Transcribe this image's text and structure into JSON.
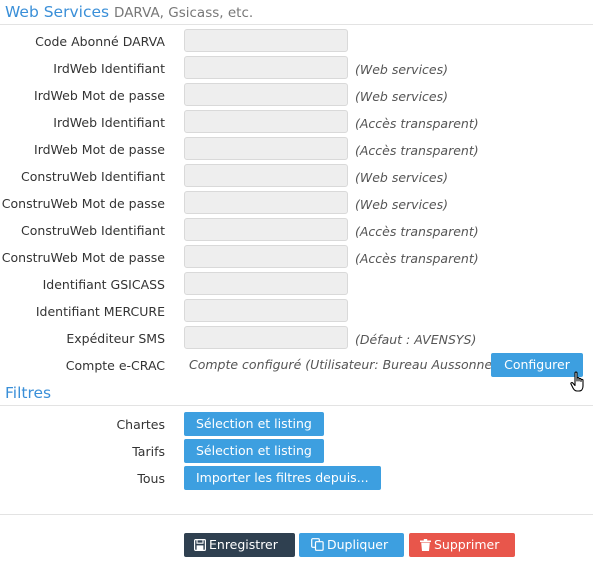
{
  "web_services": {
    "title": "Web Services",
    "subtitle": "DARVA, Gsicass, etc.",
    "fields": [
      {
        "label": "Code Abonné DARVA",
        "value": "",
        "note": ""
      },
      {
        "label": "IrdWeb Identifiant",
        "value": "",
        "note": "(Web services)"
      },
      {
        "label": "IrdWeb Mot de passe",
        "value": "",
        "note": "(Web services)"
      },
      {
        "label": "IrdWeb Identifiant",
        "value": "",
        "note": "(Accès transparent)"
      },
      {
        "label": "IrdWeb Mot de passe",
        "value": "",
        "note": "(Accès transparent)"
      },
      {
        "label": "ConstruWeb Identifiant",
        "value": "",
        "note": "(Web services)"
      },
      {
        "label": "ConstruWeb Mot de passe",
        "value": "",
        "note": "(Web services)"
      },
      {
        "label": "ConstruWeb Identifiant",
        "value": "",
        "note": "(Accès transparent)"
      },
      {
        "label": "ConstruWeb Mot de passe",
        "value": "",
        "note": "(Accès transparent)"
      },
      {
        "label": "Identifiant GSICASS",
        "value": "",
        "note": ""
      },
      {
        "label": "Identifiant MERCURE",
        "value": "",
        "note": ""
      },
      {
        "label": "Expéditeur SMS",
        "value": "",
        "note": "(Défaut : AVENSYS)"
      }
    ],
    "ecrac": {
      "label": "Compte e-CRAC",
      "status": "Compte configuré (Utilisateur: Bureau Aussonne)",
      "button": "Configurer"
    }
  },
  "filtres": {
    "title": "Filtres",
    "rows": [
      {
        "label": "Chartes",
        "button": "Sélection et listing"
      },
      {
        "label": "Tarifs",
        "button": "Sélection et listing"
      },
      {
        "label": "Tous",
        "button": "Importer les filtres depuis..."
      }
    ]
  },
  "actions": {
    "save": "Enregistrer",
    "duplicate": "Dupliquer",
    "delete": "Supprimer"
  },
  "colors": {
    "title": "#3a8fd8",
    "button_blue": "#3d9fe0",
    "button_dark": "#2f4050",
    "button_red": "#e8564b"
  }
}
